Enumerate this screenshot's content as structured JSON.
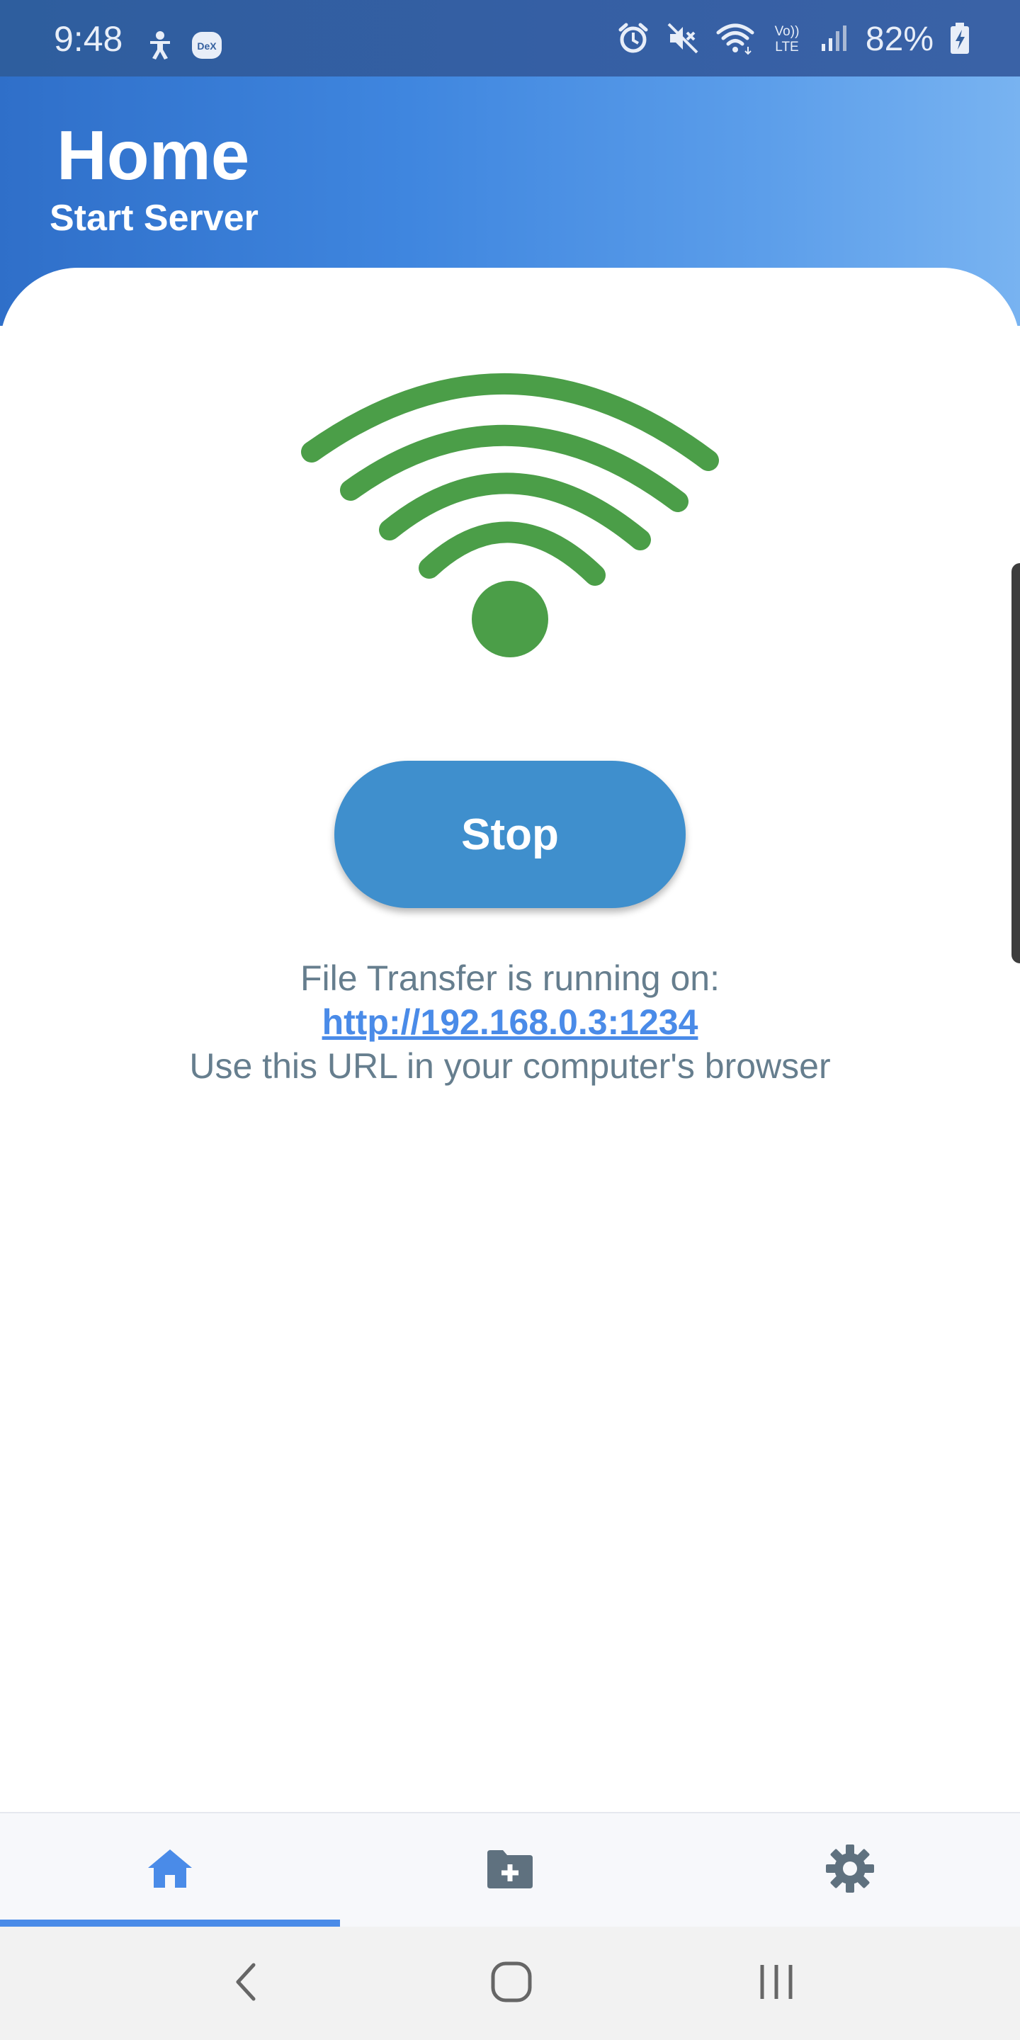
{
  "status_bar": {
    "time": "9:48",
    "left_icons": [
      "accessibility-icon",
      "dex-icon"
    ],
    "dex_label": "DeX",
    "right_icons": [
      "alarm-icon",
      "mute-icon",
      "wifi-icon",
      "volte-icon",
      "signal-icon",
      "battery-charging-icon"
    ],
    "volte_label_top": "Vo))",
    "volte_label_bottom": "LTE",
    "battery": "82%"
  },
  "header": {
    "title": "Home",
    "subtitle": "Start Server"
  },
  "main": {
    "status_icon": "wifi-icon",
    "status_color": "#4b9e48",
    "button_label": "Stop",
    "button_color": "#3f8fcd",
    "info_line1": "File Transfer is running on:",
    "url": "http://192.168.0.3:1234",
    "info_line3": "Use this URL in your computer's browser"
  },
  "bottom_nav": {
    "items": [
      {
        "icon": "home-icon",
        "active": true
      },
      {
        "icon": "folder-add-icon",
        "active": false
      },
      {
        "icon": "gear-icon",
        "active": false
      }
    ],
    "active_color": "#4a8be8",
    "inactive_color": "#5f717f"
  },
  "system_nav": {
    "buttons": [
      "back-icon",
      "home-circle-icon",
      "recents-icon"
    ]
  }
}
